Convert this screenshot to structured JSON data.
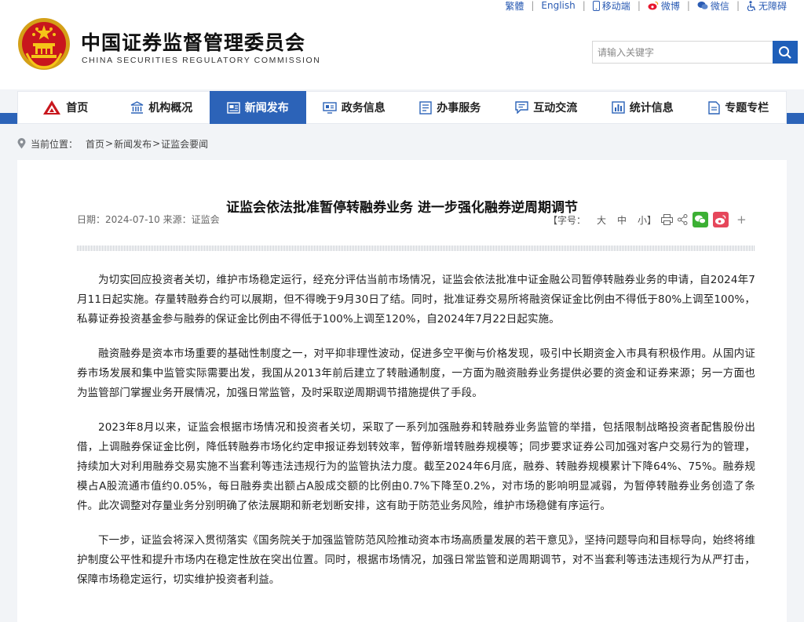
{
  "header": {
    "title_cn": "中国证券监督管理委员会",
    "title_en": "CHINA SECURITIES REGULATORY COMMISSION",
    "emblem_icon": "national-emblem-icon"
  },
  "toplinks": {
    "traditional": "繁體",
    "english": "English",
    "mobile": "移动端",
    "weibo": "微博",
    "wechat": "微信",
    "accessible": "无障碍"
  },
  "search": {
    "placeholder": "请输入关键字",
    "icon": "search-icon"
  },
  "nav": {
    "items": [
      {
        "label": "首页",
        "icon": "home-icon"
      },
      {
        "label": "机构概况",
        "icon": "institution-icon"
      },
      {
        "label": "新闻发布",
        "icon": "news-icon"
      },
      {
        "label": "政务信息",
        "icon": "gov-info-icon"
      },
      {
        "label": "办事服务",
        "icon": "service-icon"
      },
      {
        "label": "互动交流",
        "icon": "interaction-icon"
      },
      {
        "label": "统计信息",
        "icon": "statistics-icon"
      },
      {
        "label": "专题专栏",
        "icon": "topics-icon"
      }
    ],
    "active_index": 2,
    "active_color": "#2c63b8"
  },
  "breadcrumb": {
    "label": "当前位置：",
    "items": [
      "首页",
      "新闻发布",
      "证监会要闻"
    ],
    "separator": ">"
  },
  "article": {
    "title": "证监会依法批准暂停转融券业务 进一步强化融券逆周期调节",
    "date": "日期：2024-07-10",
    "source": "来源：证监会",
    "font_label": "【字号：",
    "font_large": "大",
    "font_medium": "中",
    "font_small": "小】",
    "share_plus": "+",
    "paragraphs": [
      "为切实回应投资者关切，维护市场稳定运行，经充分评估当前市场情况，证监会依法批准中证金融公司暂停转融券业务的申请，自2024年7月11日起实施。存量转融券合约可以展期，但不得晚于9月30日了结。同时，批准证券交易所将融资保证金比例由不得低于80%上调至100%，私募证券投资基金参与融券的保证金比例由不得低于100%上调至120%，自2024年7月22日起实施。",
      "融资融券是资本市场重要的基础性制度之一，对平抑非理性波动，促进多空平衡与价格发现，吸引中长期资金入市具有积极作用。从国内证券市场发展和集中监管实际需要出发，我国从2013年前后建立了转融通制度，一方面为融资融券业务提供必要的资金和证券来源；另一方面也为监管部门掌握业务开展情况，加强日常监管，及时采取逆周期调节措施提供了手段。",
      "2023年8月以来，证监会根据市场情况和投资者关切，采取了一系列加强融券和转融券业务监管的举措，包括限制战略投资者配售股份出借，上调融券保证金比例，降低转融券市场化约定申报证券划转效率，暂停新增转融券规模等；同步要求证券公司加强对客户交易行为的管理，持续加大对利用融券交易实施不当套利等违法违规行为的监管执法力度。截至2024年6月底，融券、转融券规模累计下降64%、75%。融券规模占A股流通市值约0.05%，每日融券卖出额占A股成交额的比例由0.7%下降至0.2%，对市场的影响明显减弱，为暂停转融券业务创造了条件。此次调整对存量业务分别明确了依法展期和新老划断安排，这有助于防范业务风险，维护市场稳健有序运行。",
      "下一步，证监会将深入贯彻落实《国务院关于加强监管防范风险推动资本市场高质量发展的若干意见》，坚持问题导向和目标导向，始终将维护制度公平性和提升市场内在稳定性放在突出位置。同时，根据市场情况，加强日常监管和逆周期调节，对不当套利等违法违规行为从严打击，保障市场稳定运行，切实维护投资者利益。"
    ]
  }
}
